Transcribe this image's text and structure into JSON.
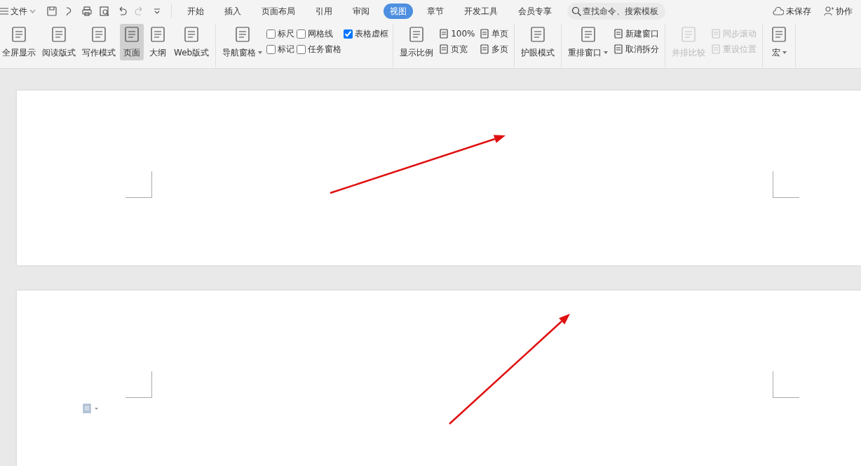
{
  "menu": {
    "label": "文件"
  },
  "tabs": [
    {
      "label": "开始",
      "selected": false
    },
    {
      "label": "插入",
      "selected": false
    },
    {
      "label": "页面布局",
      "selected": false
    },
    {
      "label": "引用",
      "selected": false
    },
    {
      "label": "审阅",
      "selected": false
    },
    {
      "label": "视图",
      "selected": true
    },
    {
      "label": "章节",
      "selected": false
    },
    {
      "label": "开发工具",
      "selected": false
    },
    {
      "label": "会员专享",
      "selected": false
    }
  ],
  "search": {
    "placeholder": "查找命令、搜索模板"
  },
  "status": {
    "save_state": "未保存",
    "share": "协作"
  },
  "ribbon": [
    {
      "items": [
        {
          "kind": "large",
          "label": "全屏显示",
          "selected": false
        },
        {
          "kind": "large",
          "label": "阅读版式",
          "selected": false
        },
        {
          "kind": "large",
          "label": "写作模式",
          "selected": false
        },
        {
          "kind": "large",
          "label": "页面",
          "selected": true
        },
        {
          "kind": "large",
          "label": "大纲",
          "selected": false
        },
        {
          "kind": "large",
          "label": "Web版式",
          "selected": false
        }
      ]
    },
    {
      "items": [
        {
          "kind": "large",
          "label": "导航窗格",
          "selected": false,
          "dropdown": true
        },
        {
          "kind": "stack",
          "items": [
            {
              "kind": "checkbox",
              "label": "标尺",
              "checked": false
            },
            {
              "kind": "checkbox",
              "label": "标记",
              "checked": false
            }
          ]
        },
        {
          "kind": "stack",
          "items": [
            {
              "kind": "checkbox",
              "label": "网格线",
              "checked": false
            },
            {
              "kind": "checkbox",
              "label": "任务窗格",
              "checked": false
            }
          ]
        },
        {
          "kind": "stack",
          "items": [
            {
              "kind": "checkbox",
              "label": "表格虚框",
              "checked": true
            }
          ]
        }
      ]
    },
    {
      "items": [
        {
          "kind": "large",
          "label": "显示比例",
          "selected": false
        },
        {
          "kind": "stack",
          "items": [
            {
              "kind": "small",
              "label": "100%",
              "disabled": false
            },
            {
              "kind": "small",
              "label": "页宽",
              "disabled": false
            }
          ]
        },
        {
          "kind": "stack",
          "items": [
            {
              "kind": "small",
              "label": "单页",
              "disabled": false
            },
            {
              "kind": "small",
              "label": "多页",
              "disabled": false
            }
          ]
        }
      ]
    },
    {
      "items": [
        {
          "kind": "large",
          "label": "护眼模式",
          "selected": false
        }
      ]
    },
    {
      "items": [
        {
          "kind": "large",
          "label": "重排窗口",
          "selected": false,
          "dropdown": true
        },
        {
          "kind": "stack",
          "items": [
            {
              "kind": "small",
              "label": "新建窗口",
              "disabled": false
            },
            {
              "kind": "small",
              "label": "取消拆分",
              "disabled": false
            }
          ]
        }
      ]
    },
    {
      "items": [
        {
          "kind": "large",
          "label": "并排比较",
          "selected": false,
          "disabled": true
        },
        {
          "kind": "stack",
          "items": [
            {
              "kind": "small",
              "label": "同步滚动",
              "disabled": true
            },
            {
              "kind": "small",
              "label": "重设位置",
              "disabled": true
            }
          ]
        }
      ]
    },
    {
      "items": [
        {
          "kind": "large",
          "label": "宏",
          "selected": false,
          "dropdown": true
        }
      ]
    }
  ]
}
